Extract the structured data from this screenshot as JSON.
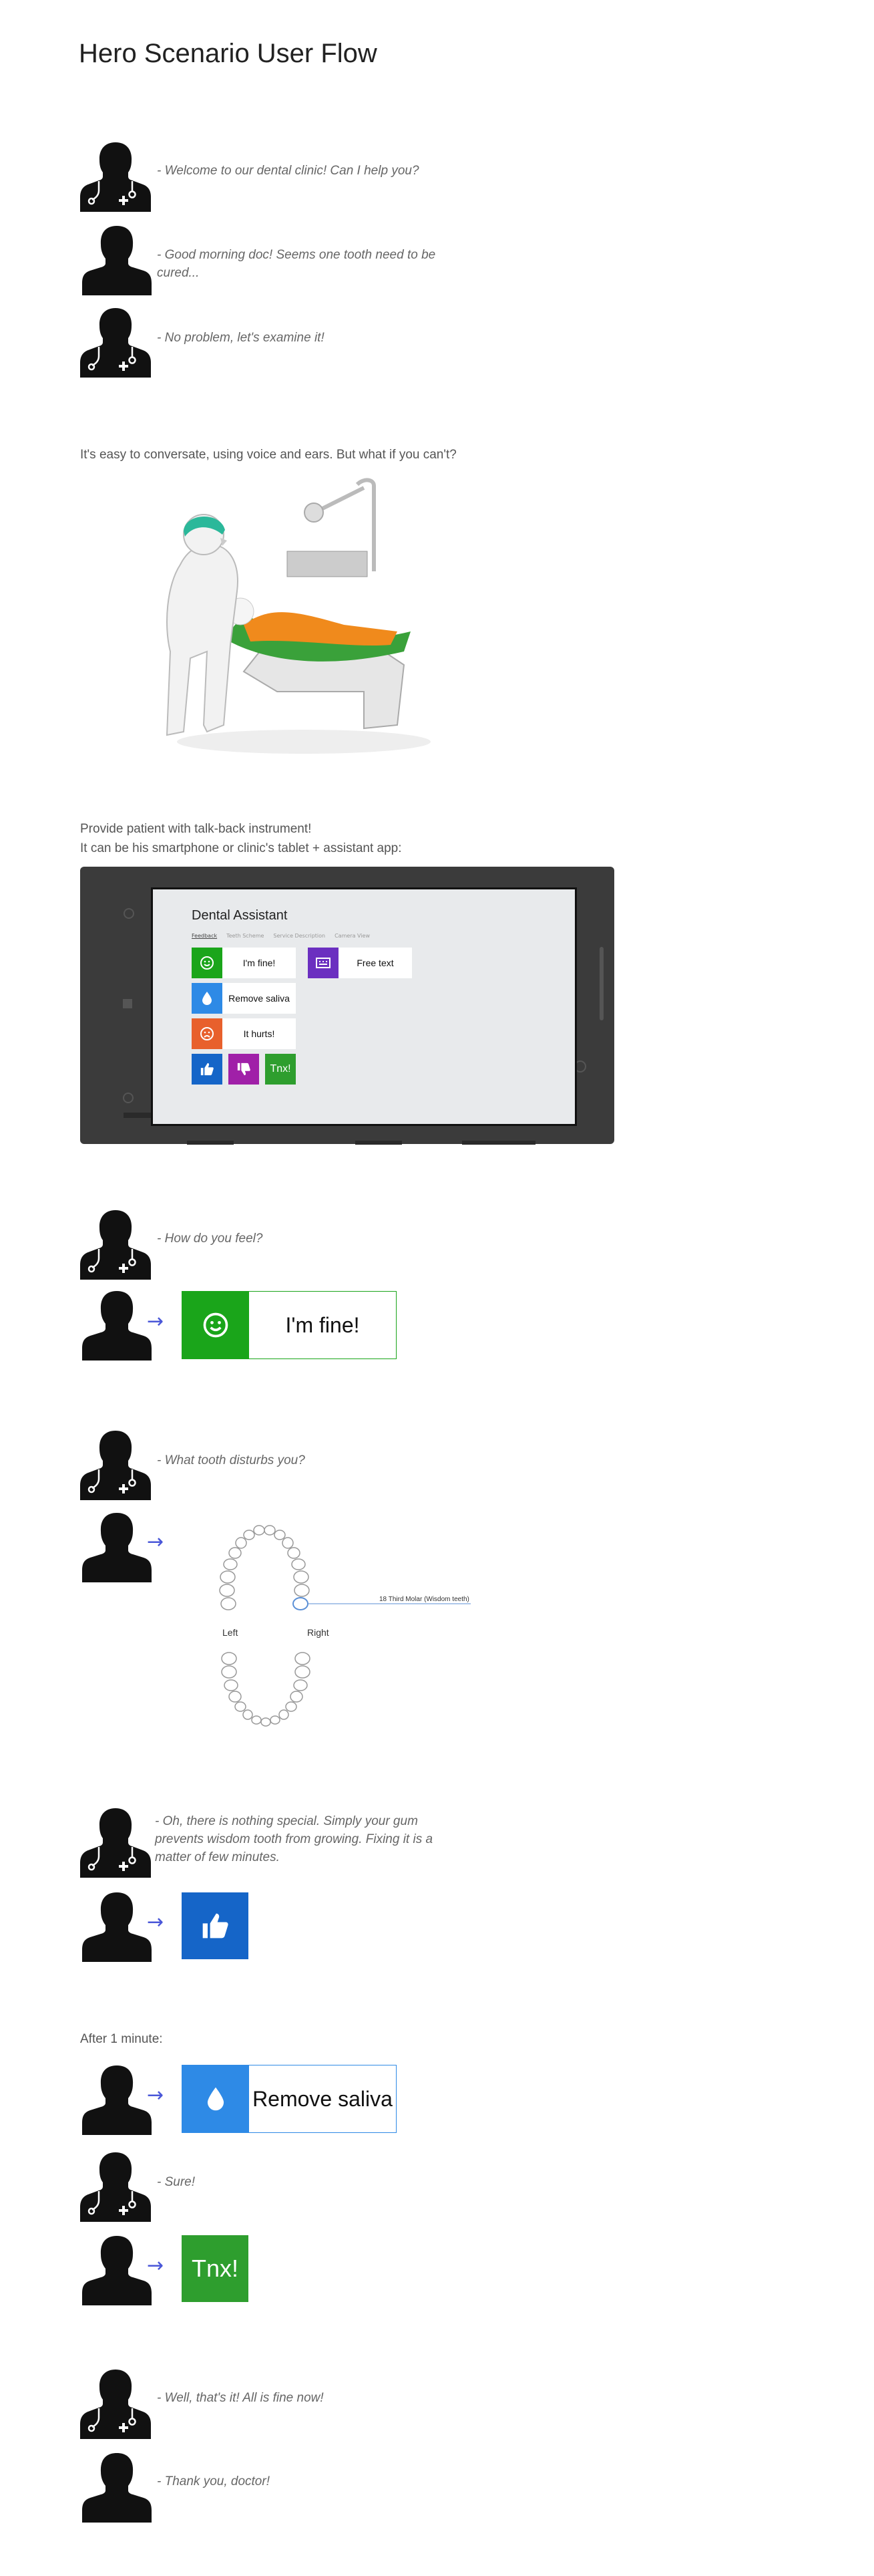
{
  "page": {
    "title": "Hero Scenario User Flow"
  },
  "intro_dialog": [
    {
      "speaker": "doctor",
      "text": "- Welcome to our dental clinic! Can I help you?"
    },
    {
      "speaker": "patient",
      "text": "- Good morning doc! Seems one tooth need to be cured..."
    },
    {
      "speaker": "doctor",
      "text": "- No problem, let's examine it!"
    }
  ],
  "conversation_note": "It's easy to conversate, using voice and ears. But what if you can't?",
  "instrument_note": {
    "line1": "Provide patient with talk-back instrument!",
    "line2": "It can be his smartphone or clinic's tablet + assistant app:"
  },
  "app": {
    "title": "Dental Assistant",
    "tabs": [
      "Feedback",
      "Teeth Scheme",
      "Service Description",
      "Camera View"
    ],
    "buttons": {
      "fine": "I'm fine!",
      "saliva": "Remove saliva",
      "hurts": "It hurts!",
      "free_text": "Free text",
      "thanks": "Tnx!"
    }
  },
  "step_feel": {
    "question": "- How do you feel?",
    "answer": "I'm fine!"
  },
  "step_tooth": {
    "question": "- What tooth disturbs you?",
    "left": "Left",
    "right": "Right",
    "tooth_label": "18 Third Molar (Wisdom teeth)"
  },
  "step_gum": {
    "text_line1": "- Oh, there is nothing special. Simply your gum",
    "text_line2": "prevents wisdom tooth from growing. Fixing it is a",
    "text_line3": "matter of few minutes."
  },
  "after_minute": {
    "label": "After 1 minute:",
    "answer": "Remove saliva",
    "doctor_reply": "- Sure!",
    "thanks": "Tnx!"
  },
  "closing": {
    "doctor": "- Well, that's it! All is fine now!",
    "patient": "- Thank you, doctor!"
  },
  "colors": {
    "green": "#1aa51a",
    "blue": "#2e8ae6",
    "orange": "#e8602c",
    "darkblue": "#1565c8",
    "purple": "#a020a8",
    "violet": "#6b2fc0",
    "thanks_green": "#2e9e2e"
  }
}
